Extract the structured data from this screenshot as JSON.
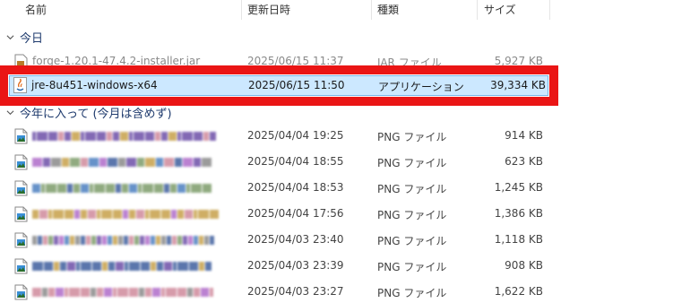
{
  "columns": {
    "name": "名前",
    "date": "更新日時",
    "type": "種類",
    "size": "サイズ"
  },
  "groups": {
    "today": "今日",
    "this_year": "今年に入って (今月は含めず)"
  },
  "today_files": [
    {
      "name": "forge-1.20.1-47.4.2-installer.jar",
      "date": "2025/06/15 11:37",
      "type": "JAR ファイル",
      "size": "5,927 KB"
    },
    {
      "name": "jre-8u451-windows-x64",
      "date": "2025/06/15 11:50",
      "type": "アプリケーション",
      "size": "39,334 KB"
    }
  ],
  "year_files": [
    {
      "date": "2025/04/04 19:25",
      "type": "PNG ファイル",
      "size": "914 KB"
    },
    {
      "date": "2025/04/04 18:55",
      "type": "PNG ファイル",
      "size": "623 KB"
    },
    {
      "date": "2025/04/04 18:53",
      "type": "PNG ファイル",
      "size": "1,245 KB"
    },
    {
      "date": "2025/04/04 17:56",
      "type": "PNG ファイル",
      "size": "1,386 KB"
    },
    {
      "date": "2025/04/03 23:40",
      "type": "PNG ファイル",
      "size": "1,118 KB"
    },
    {
      "date": "2025/04/03 23:39",
      "type": "PNG ファイル",
      "size": "908 KB"
    },
    {
      "date": "2025/04/03 23:27",
      "type": "PNG ファイル",
      "size": "1,622 KB"
    }
  ],
  "icons": {
    "chevron": "chevron-down-icon",
    "jar": "jar-file-icon",
    "app": "java-installer-icon",
    "png": "png-file-icon"
  },
  "colors": {
    "selection_bg": "#cce8ff",
    "selection_border": "#7ab6e8",
    "highlight_box": "#ea1515",
    "group_title": "#1e3a6d"
  }
}
